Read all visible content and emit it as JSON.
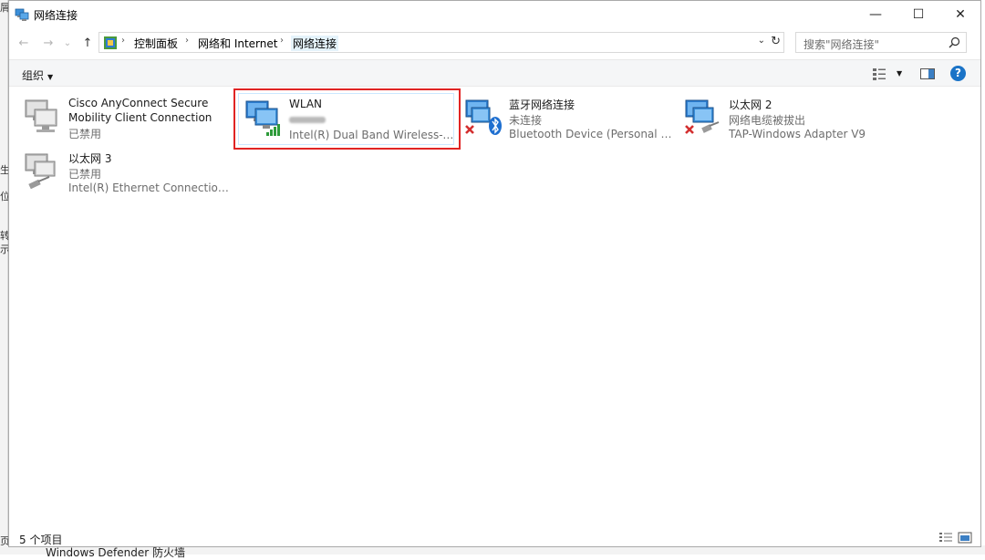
{
  "background": {
    "left_glyphs": [
      "屑",
      "生",
      "位",
      "转",
      "示",
      "页"
    ],
    "bottom_text": "Windows Defender 防火墙"
  },
  "window": {
    "title": "网络连接",
    "controls": {
      "minimize": "—",
      "maximize": "☐",
      "close": "✕"
    }
  },
  "nav": {
    "back": "←",
    "forward": "→",
    "recent": "⌄",
    "up": "↑",
    "breadcrumb": [
      "控制面板",
      "网络和 Internet",
      "网络连接"
    ],
    "search_placeholder": "搜索\"网络连接\""
  },
  "toolbar": {
    "organize_label": "组织",
    "organize_caret": "▼",
    "view_caret": "▼",
    "help": "?"
  },
  "connections": [
    {
      "name": "Cisco AnyConnect Secure Mobility Client Connection",
      "status": "已禁用",
      "device": "",
      "icon": "network-adapter-disabled-icon"
    },
    {
      "name": "WLAN",
      "status": "",
      "device": "Intel(R) Dual Band Wireless-A...",
      "icon": "wlan-signal-icon",
      "selected": true
    },
    {
      "name": "蓝牙网络连接",
      "status": "未连接",
      "device": "Bluetooth Device (Personal Ar...",
      "icon": "bluetooth-icon"
    },
    {
      "name": "以太网 2",
      "status": "网络电缆被拔出",
      "device": "TAP-Windows Adapter V9",
      "icon": "ethernet-unplugged-icon"
    },
    {
      "name": "以太网 3",
      "status": "已禁用",
      "device": "Intel(R) Ethernet Connection I2...",
      "icon": "ethernet-disabled-icon"
    }
  ],
  "status_bar": {
    "count_text": "5 个项目"
  },
  "colors": {
    "highlight": "#e02424",
    "help_blue": "#1a73c7",
    "error_red": "#d32f2f"
  }
}
